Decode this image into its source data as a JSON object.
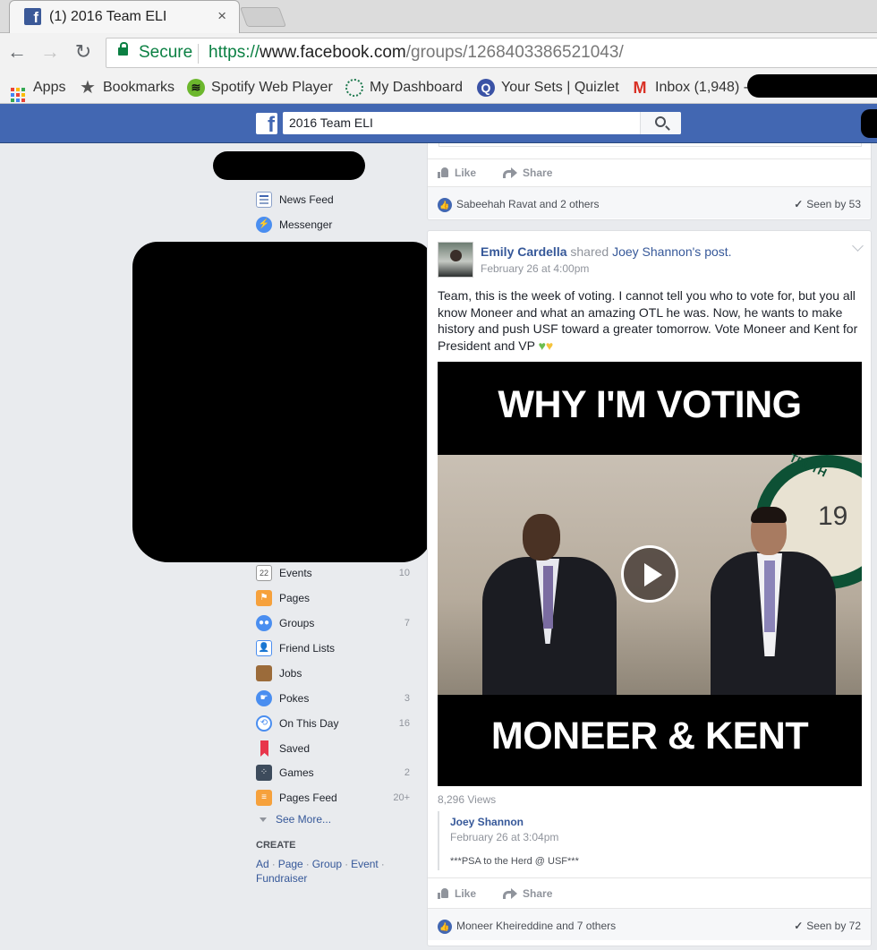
{
  "browser": {
    "tab_title": "(1) 2016 Team ELI",
    "tab_close": "×",
    "secure_label": "Secure",
    "url_scheme": "https://",
    "url_host": "www.facebook.com",
    "url_path": "/groups/1268403386521043/"
  },
  "bookmarks": [
    {
      "label": "Apps",
      "icon": "apps-grid-icon"
    },
    {
      "label": "Bookmarks",
      "icon": "star-icon"
    },
    {
      "label": "Spotify Web Player",
      "icon": "spotify-icon"
    },
    {
      "label": "My Dashboard",
      "icon": "dashboard-icon"
    },
    {
      "label": "Your Sets | Quizlet",
      "icon": "quizlet-icon"
    },
    {
      "label": "Inbox (1,948) -",
      "icon": "gmail-icon"
    }
  ],
  "fb": {
    "search_value": "2016 Team ELI"
  },
  "nav": {
    "top_items": [
      {
        "label": "News Feed",
        "icon": "news-feed-icon"
      },
      {
        "label": "Messenger",
        "icon": "messenger-icon"
      }
    ],
    "items": [
      {
        "label": "Events",
        "count": "10",
        "icon": "events-icon"
      },
      {
        "label": "Pages",
        "count": "",
        "icon": "pages-icon"
      },
      {
        "label": "Groups",
        "count": "7",
        "icon": "groups-icon"
      },
      {
        "label": "Friend Lists",
        "count": "",
        "icon": "friend-lists-icon"
      },
      {
        "label": "Jobs",
        "count": "",
        "icon": "jobs-icon"
      },
      {
        "label": "Pokes",
        "count": "3",
        "icon": "pokes-icon"
      },
      {
        "label": "On This Day",
        "count": "16",
        "icon": "on-this-day-icon"
      },
      {
        "label": "Saved",
        "count": "",
        "icon": "saved-icon"
      },
      {
        "label": "Games",
        "count": "2",
        "icon": "games-icon"
      },
      {
        "label": "Pages Feed",
        "count": "20+",
        "icon": "pages-feed-icon"
      }
    ],
    "events_day": "22",
    "see_more": "See More...",
    "create_heading": "CREATE",
    "create_links": [
      "Ad",
      "Page",
      "Group",
      "Event",
      "Fundraiser"
    ]
  },
  "post1": {
    "like": "Like",
    "share": "Share",
    "likers": "Sabeehah Ravat and 2 others",
    "seen": "Seen by 53"
  },
  "post2": {
    "author": "Emily Cardella",
    "shared_text": "shared",
    "shared_from": "Joey Shannon",
    "shared_suffix": "'s post.",
    "time": "February 26 at 4:00pm",
    "body": "Team, this is the week of voting. I cannot tell you who to vote for, but you all know Moneer and what an amazing OTL he was. Now, he wants to make history and push USF toward a greater tomorrow. Vote Moneer and Kent for President and VP",
    "video_top": "WHY I'M VOTING",
    "video_bottom": "MONEER & KENT",
    "seal_text": "TRUTH",
    "seal_number": "19",
    "views": "8,296 Views",
    "quote_author": "Joey Shannon",
    "quote_time": "February 26 at 3:04pm",
    "quote_text": "***PSA to the Herd @ USF***",
    "like": "Like",
    "share": "Share",
    "likers": "Moneer Kheireddine and 7 others",
    "seen": "Seen by 72"
  },
  "colors": {
    "fb_blue": "#4267b2",
    "link": "#365899",
    "secure_green": "#0b8043"
  }
}
